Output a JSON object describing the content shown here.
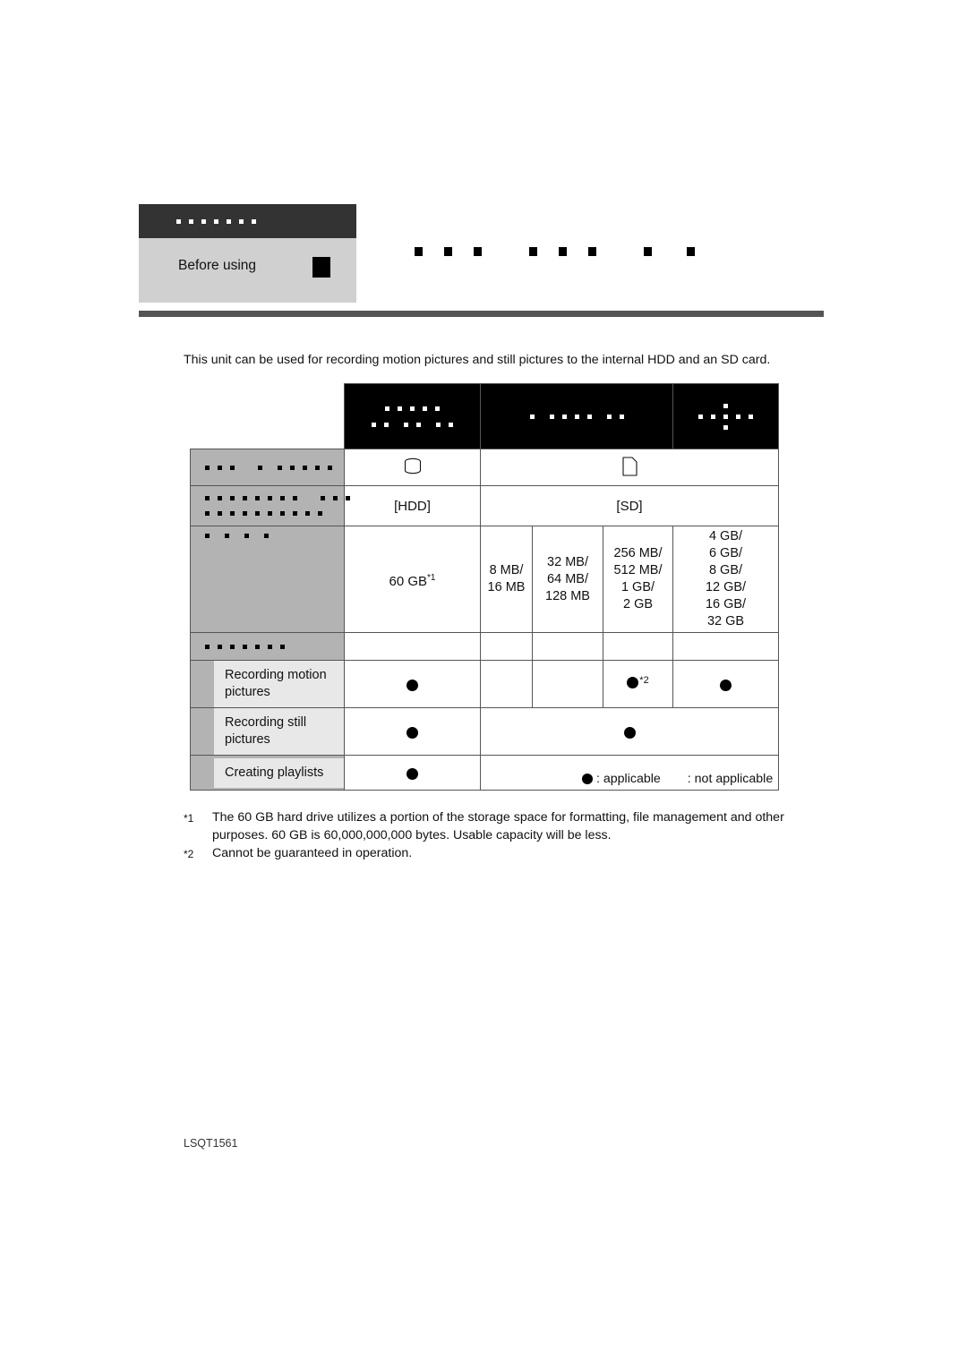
{
  "chapter_header": {
    "label": "Before using",
    "bar_redaction_dots": 7,
    "marker_icon": "black-square-marker"
  },
  "title_redaction_groups": [
    3,
    3,
    2
  ],
  "intro_paragraph": "This unit can be used for recording motion pictures and still pictures to the internal HDD and an SD card.",
  "table": {
    "header_black_cells": {
      "hdd_group": {
        "line1_dots": 5,
        "line2_dots": 7
      },
      "sd_group": {
        "line1_dots": 8
      },
      "sd_extra": {
        "line1_dots": 1,
        "line2_dots": 5,
        "line3_dots": 1
      }
    },
    "media_icons": {
      "hdd": "hdd-disc-icon",
      "sd": "sd-card-icon"
    },
    "media_tags": {
      "hdd": "[HDD]",
      "sd": "[SD]"
    },
    "row_labels_redacted": {
      "media_row_dots": 9,
      "tag_row_line1_dots": 11,
      "tag_row_line2_dots": 10,
      "capacity_row_dots": 4,
      "feature_group_dots": 7
    },
    "capacities": {
      "hdd": "60 GB",
      "hdd_footnote": "*1",
      "sd_8_16": "8 MB/\n16 MB",
      "sd_32_128": "32 MB/\n64 MB/\n128 MB",
      "sd_256_2gb": "256 MB/\n512 MB/\n1 GB/\n2 GB",
      "sd_4_32gb": "4 GB/\n6 GB/\n8 GB/\n12 GB/\n16 GB/\n32 GB"
    },
    "capacity_lines": {
      "sd_8_16": [
        "8 MB/",
        "16 MB"
      ],
      "sd_32_128": [
        "32 MB/",
        "64 MB/",
        "128 MB"
      ],
      "sd_256_2gb": [
        "256 MB/",
        "512 MB/",
        "1 GB/",
        "2 GB"
      ],
      "sd_4_32gb": [
        "4 GB/",
        "6 GB/",
        "8 GB/",
        "12 GB/",
        "16 GB/",
        "32 GB"
      ]
    },
    "features": [
      {
        "label": "Recording motion pictures",
        "hdd": "applicable",
        "sd_8_16": "not applicable",
        "sd_32_128": "not applicable",
        "sd_256_2gb": "applicable",
        "sd_256_2gb_footnote": "*2",
        "sd_4_32gb": "applicable"
      },
      {
        "label": "Recording still pictures",
        "hdd": "applicable",
        "sd_all": "applicable"
      },
      {
        "label": "Creating playlists",
        "hdd": "applicable",
        "sd_all": "not applicable"
      }
    ]
  },
  "legend": {
    "applicable_text": ": applicable",
    "not_applicable_text": ": not applicable"
  },
  "footnotes": [
    {
      "marker": "*1",
      "text": "The 60 GB hard drive utilizes a portion of the storage space for formatting, file management and other purposes. 60 GB is 60,000,000,000 bytes. Usable capacity will be less."
    },
    {
      "marker": "*2",
      "text": "Cannot be guaranteed in operation."
    }
  ],
  "page_code": "LSQT1561",
  "colors": {
    "header_bar": "#333333",
    "header_body": "#d0d0d0",
    "rule": "#555555",
    "table_header_black": "#000000",
    "table_row_gray": "#b3b3b3",
    "table_label_lightgray": "#e8e8e8",
    "border": "#555555"
  }
}
